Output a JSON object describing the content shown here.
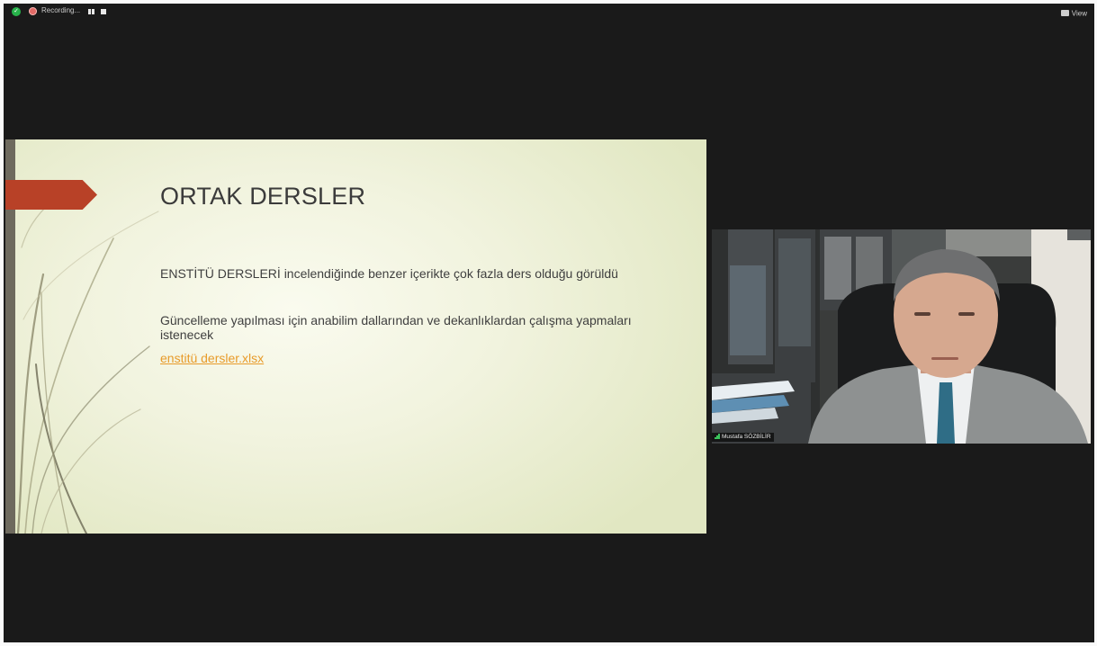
{
  "topbar": {
    "recording_label": "Recording...",
    "view_label": "View"
  },
  "slide": {
    "title": "ORTAK DERSLER",
    "paragraph1": "ENSTİTÜ DERSLERİ incelendiğinde benzer içerikte çok fazla ders olduğu görüldü",
    "paragraph2": "Güncelleme yapılması için anabilim dallarından ve dekanlıklardan çalışma yapmaları istenecek",
    "link": "enstitü dersler.xlsx",
    "colors": {
      "accent": "#b84127",
      "link": "#e89b2a",
      "background": "#f1f3de"
    }
  },
  "participant": {
    "name": "Mustafa SÖZBİLİR"
  }
}
